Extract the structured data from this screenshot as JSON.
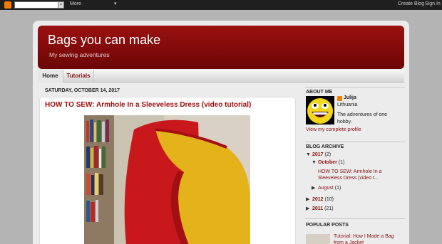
{
  "navbar": {
    "more": "More",
    "create_blog": "Create Blog",
    "sign_in": "Sign In"
  },
  "header": {
    "title": "Bags you can make",
    "description": "My sewing adventures"
  },
  "tabs": [
    {
      "label": "Home"
    },
    {
      "label": "Tutorials"
    }
  ],
  "post": {
    "date": "SATURDAY, OCTOBER 14, 2017",
    "title": "HOW TO SEW: Armhole In a Sleeveless Dress (video tutorial)"
  },
  "sidebar": {
    "about_title": "ABOUT ME",
    "profile_name": "Julija",
    "profile_location": "Lithuania",
    "profile_about": "The adventures of one hobby.",
    "profile_link": "View my complete profile",
    "archive_title": "BLOG ARCHIVE",
    "archive": {
      "y2017": {
        "year": "2017",
        "count": "(2)"
      },
      "october": {
        "month": "October",
        "count": "(1)"
      },
      "post": "HOW TO SEW: Armhole In a Sleeveless Dress (video t...",
      "august": {
        "month": "August",
        "count": "(1)"
      },
      "y2012": {
        "year": "2012",
        "count": "(10)"
      },
      "y2011": {
        "year": "2011",
        "count": "(21)"
      }
    },
    "popular_title": "POPULAR POSTS",
    "popular_post": "Tutorial: How I Made a Bag from a Jacket"
  },
  "colors": {
    "accent": "#8a1010",
    "header_top": "#9a1010",
    "header_bottom": "#6c0606"
  }
}
